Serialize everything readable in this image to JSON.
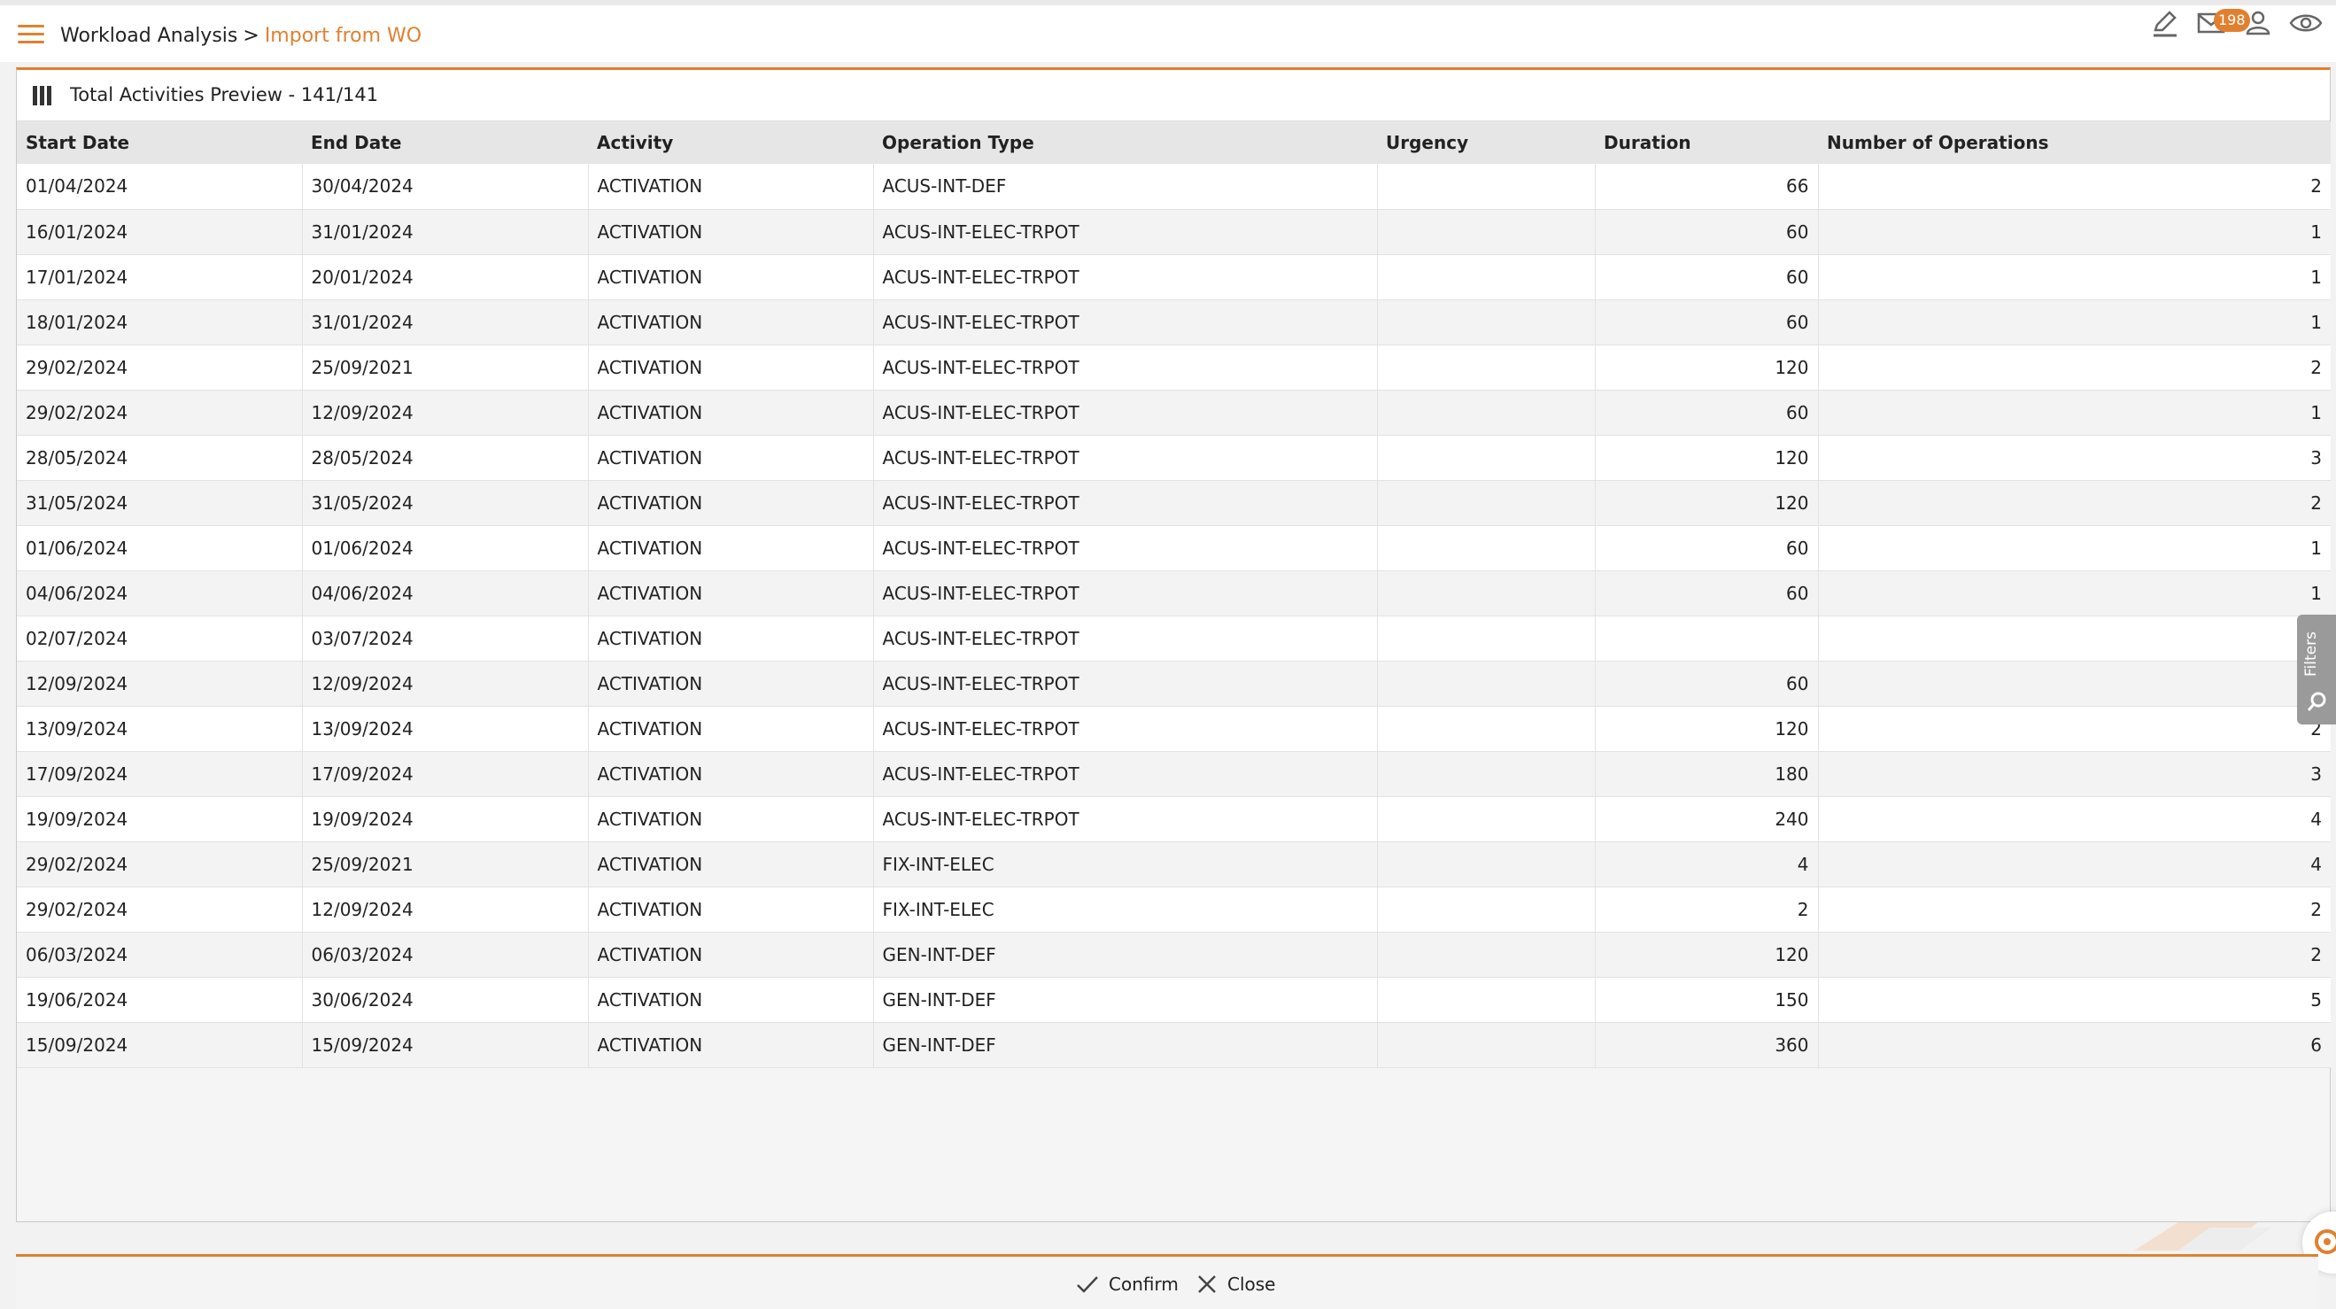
{
  "header": {
    "breadcrumb_root": "Workload Analysis",
    "breadcrumb_separator": ">",
    "breadcrumb_current": "Import from WO",
    "notification_count": "198",
    "icons": [
      "menu-icon",
      "edit-icon",
      "mail-icon",
      "user-icon",
      "eye-icon"
    ]
  },
  "panel": {
    "title": "Total Activities Preview - 141/141"
  },
  "table": {
    "columns": [
      "Start Date",
      "End Date",
      "Activity",
      "Operation Type",
      "Urgency",
      "Duration",
      "Number of Operations"
    ],
    "rows": [
      [
        "01/04/2024",
        "30/04/2024",
        "ACTIVATION",
        "ACUS-INT-DEF",
        "",
        "66",
        "2"
      ],
      [
        "16/01/2024",
        "31/01/2024",
        "ACTIVATION",
        "ACUS-INT-ELEC-TRPOT",
        "",
        "60",
        "1"
      ],
      [
        "17/01/2024",
        "20/01/2024",
        "ACTIVATION",
        "ACUS-INT-ELEC-TRPOT",
        "",
        "60",
        "1"
      ],
      [
        "18/01/2024",
        "31/01/2024",
        "ACTIVATION",
        "ACUS-INT-ELEC-TRPOT",
        "",
        "60",
        "1"
      ],
      [
        "29/02/2024",
        "25/09/2021",
        "ACTIVATION",
        "ACUS-INT-ELEC-TRPOT",
        "",
        "120",
        "2"
      ],
      [
        "29/02/2024",
        "12/09/2024",
        "ACTIVATION",
        "ACUS-INT-ELEC-TRPOT",
        "",
        "60",
        "1"
      ],
      [
        "28/05/2024",
        "28/05/2024",
        "ACTIVATION",
        "ACUS-INT-ELEC-TRPOT",
        "",
        "120",
        "3"
      ],
      [
        "31/05/2024",
        "31/05/2024",
        "ACTIVATION",
        "ACUS-INT-ELEC-TRPOT",
        "",
        "120",
        "2"
      ],
      [
        "01/06/2024",
        "01/06/2024",
        "ACTIVATION",
        "ACUS-INT-ELEC-TRPOT",
        "",
        "60",
        "1"
      ],
      [
        "04/06/2024",
        "04/06/2024",
        "ACTIVATION",
        "ACUS-INT-ELEC-TRPOT",
        "",
        "60",
        "1"
      ],
      [
        "02/07/2024",
        "03/07/2024",
        "ACTIVATION",
        "ACUS-INT-ELEC-TRPOT",
        "",
        "",
        ""
      ],
      [
        "12/09/2024",
        "12/09/2024",
        "ACTIVATION",
        "ACUS-INT-ELEC-TRPOT",
        "",
        "60",
        ""
      ],
      [
        "13/09/2024",
        "13/09/2024",
        "ACTIVATION",
        "ACUS-INT-ELEC-TRPOT",
        "",
        "120",
        "2"
      ],
      [
        "17/09/2024",
        "17/09/2024",
        "ACTIVATION",
        "ACUS-INT-ELEC-TRPOT",
        "",
        "180",
        "3"
      ],
      [
        "19/09/2024",
        "19/09/2024",
        "ACTIVATION",
        "ACUS-INT-ELEC-TRPOT",
        "",
        "240",
        "4"
      ],
      [
        "29/02/2024",
        "25/09/2021",
        "ACTIVATION",
        "FIX-INT-ELEC",
        "",
        "4",
        "4"
      ],
      [
        "29/02/2024",
        "12/09/2024",
        "ACTIVATION",
        "FIX-INT-ELEC",
        "",
        "2",
        "2"
      ],
      [
        "06/03/2024",
        "06/03/2024",
        "ACTIVATION",
        "GEN-INT-DEF",
        "",
        "120",
        "2"
      ],
      [
        "19/06/2024",
        "30/06/2024",
        "ACTIVATION",
        "GEN-INT-DEF",
        "",
        "150",
        "5"
      ],
      [
        "15/09/2024",
        "15/09/2024",
        "ACTIVATION",
        "GEN-INT-DEF",
        "",
        "360",
        "6"
      ]
    ]
  },
  "filters": {
    "label": "Filters"
  },
  "footer": {
    "confirm_label": "Confirm",
    "close_label": "Close"
  },
  "colors": {
    "accent": "#e0802f",
    "header_bg": "#e6e6e6",
    "row_alt": "#f3f3f3"
  }
}
